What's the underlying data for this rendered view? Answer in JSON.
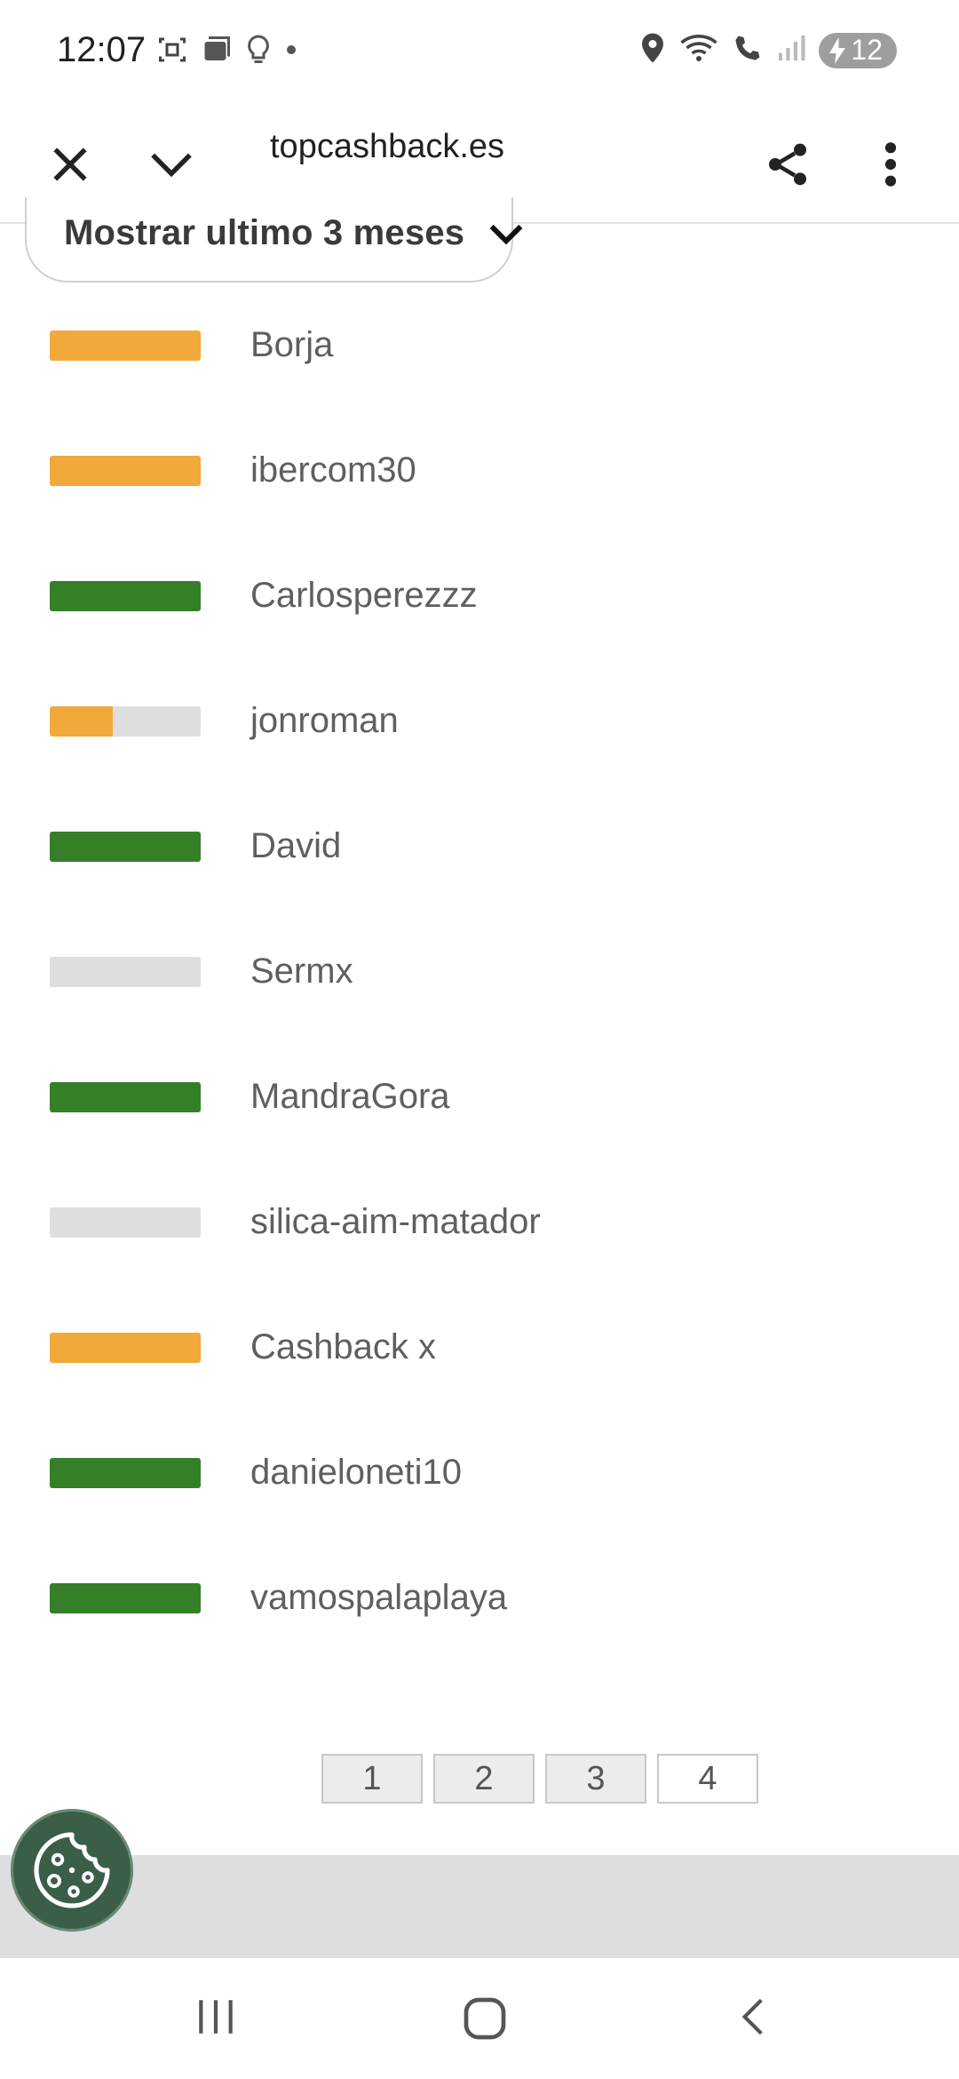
{
  "status_bar": {
    "time": "12:07",
    "battery": "12"
  },
  "toolbar": {
    "url": "topcashback.es"
  },
  "filter": {
    "selected": "Mostrar ultimo 3 meses"
  },
  "colors": {
    "orange": "#f2a93b",
    "green": "#357f28",
    "gray": "#dedede",
    "cookie_bg": "#3b5e49"
  },
  "list": [
    {
      "name": "Borja",
      "color": "orange",
      "fill": 1.0
    },
    {
      "name": "ibercom30",
      "color": "orange",
      "fill": 1.0
    },
    {
      "name": "Carlosperezzz",
      "color": "green",
      "fill": 1.0
    },
    {
      "name": "jonroman",
      "color": "orange",
      "fill": 0.42
    },
    {
      "name": "David",
      "color": "green",
      "fill": 1.0
    },
    {
      "name": "Sermx",
      "color": "gray",
      "fill": 0.0
    },
    {
      "name": "MandraGora",
      "color": "green",
      "fill": 1.0
    },
    {
      "name": "silica-aim-matador",
      "color": "gray",
      "fill": 0.0
    },
    {
      "name": "Cashback x",
      "color": "orange",
      "fill": 1.0
    },
    {
      "name": "danieloneti10",
      "color": "green",
      "fill": 1.0
    },
    {
      "name": "vamospalaplaya",
      "color": "green",
      "fill": 1.0
    }
  ],
  "pagination": {
    "pages": [
      "1",
      "2",
      "3",
      "4"
    ],
    "current": "4"
  }
}
